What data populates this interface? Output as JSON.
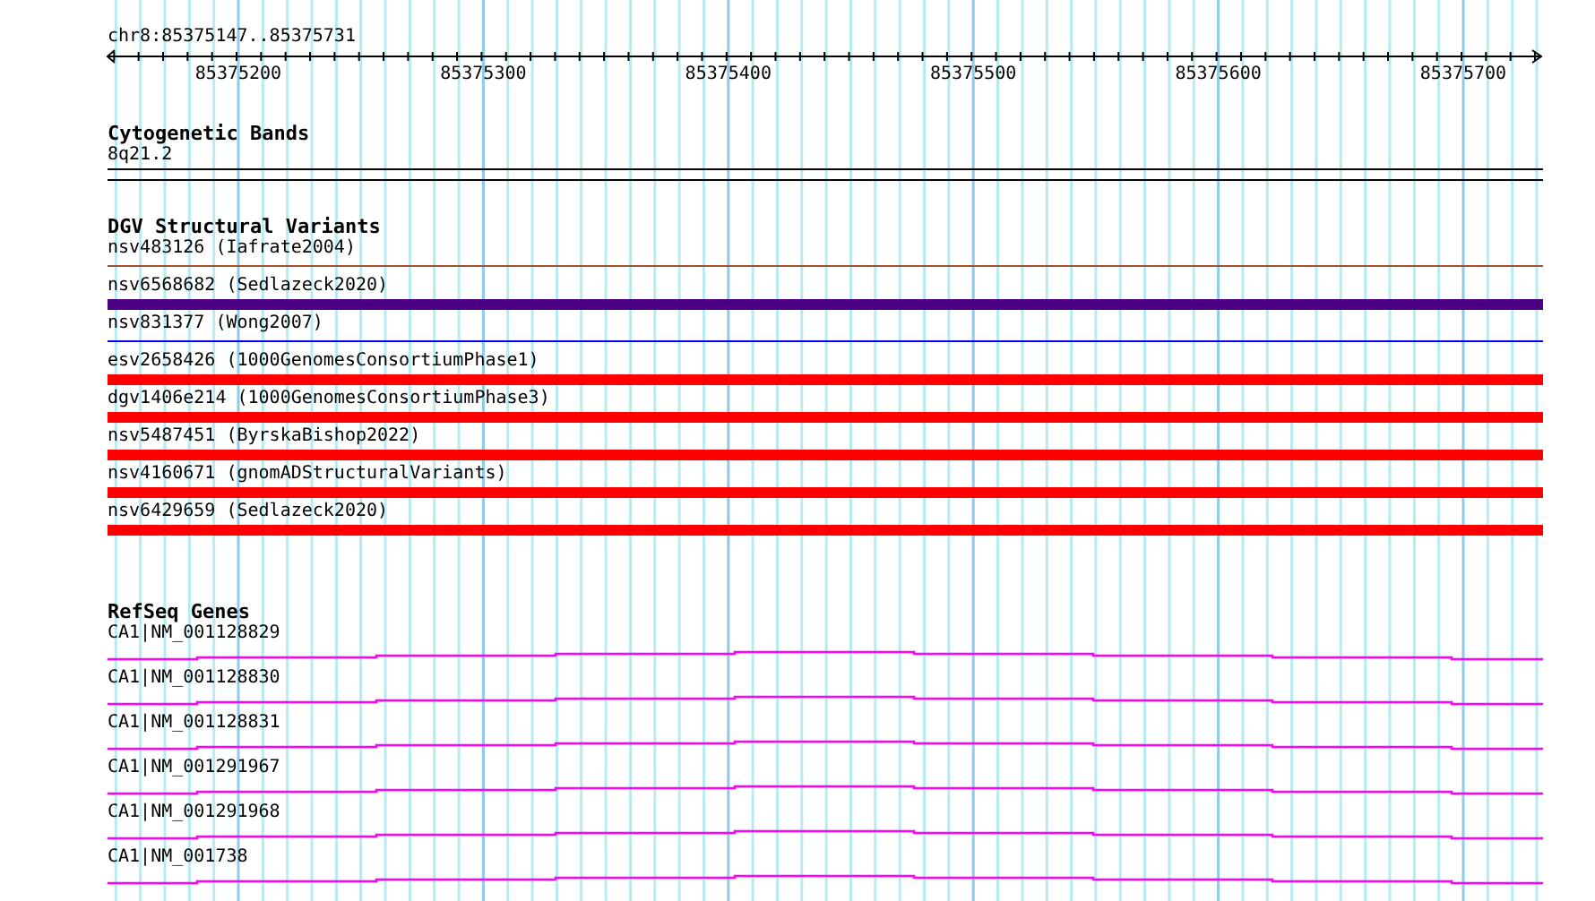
{
  "position": "chr8:85375147..85375731",
  "ruler": {
    "ticks": [
      "85375200",
      "85375300",
      "85375400",
      "85375500",
      "85375600",
      "85375700"
    ]
  },
  "tracks": [
    {
      "title": "Cytogenetic Bands",
      "kind": "bands",
      "items": [
        {
          "label": "8q21.2"
        }
      ]
    },
    {
      "title": "DGV Structural Variants",
      "kind": "variants",
      "items": [
        {
          "label": "nsv483126 (Iafrate2004)",
          "color": "#a0522d",
          "kind": "thin"
        },
        {
          "label": "nsv6568682 (Sedlazeck2020)",
          "color": "#4b0082",
          "kind": "thick"
        },
        {
          "label": "nsv831377 (Wong2007)",
          "color": "#0000ff",
          "kind": "thin"
        },
        {
          "label": "esv2658426 (1000GenomesConsortiumPhase1)",
          "color": "#ff0000",
          "kind": "thick"
        },
        {
          "label": "dgv1406e214 (1000GenomesConsortiumPhase3)",
          "color": "#ff0000",
          "kind": "thick"
        },
        {
          "label": "nsv5487451 (ByrskaBishop2022)",
          "color": "#ff0000",
          "kind": "thick"
        },
        {
          "label": "nsv4160671 (gnomADStructuralVariants)",
          "color": "#ff0000",
          "kind": "thick"
        },
        {
          "label": "nsv6429659 (Sedlazeck2020)",
          "color": "#ff0000",
          "kind": "thick"
        }
      ]
    },
    {
      "title": "RefSeq Genes",
      "kind": "genes",
      "items": [
        {
          "label": "CA1|NM_001128829"
        },
        {
          "label": "CA1|NM_001128830"
        },
        {
          "label": "CA1|NM_001128831"
        },
        {
          "label": "CA1|NM_001291967"
        },
        {
          "label": "CA1|NM_001291968"
        },
        {
          "label": "CA1|NM_001738"
        }
      ]
    }
  ]
}
